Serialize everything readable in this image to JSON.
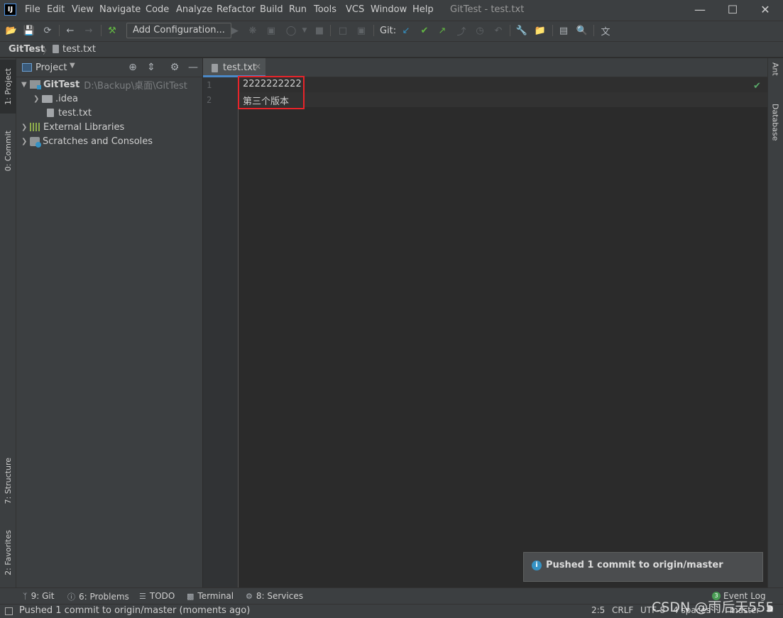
{
  "window": {
    "title": "GitTest - test.txt",
    "app_icon": "IJ",
    "minimize_glyph": "—",
    "maximize_glyph": "☐",
    "close_glyph": "✕"
  },
  "menu": [
    "File",
    "Edit",
    "View",
    "Navigate",
    "Code",
    "Analyze",
    "Refactor",
    "Build",
    "Run",
    "Tools",
    "VCS",
    "Window",
    "Help"
  ],
  "toolbar": {
    "add_configuration": "Add Configuration...",
    "git_label": "Git:"
  },
  "breadcrumb": {
    "project": "GitTest",
    "separator": "〉",
    "file": "test.txt"
  },
  "left_tabs": {
    "project": "1: Project",
    "commit": "0: Commit",
    "structure": "7: Structure",
    "favorites": "2: Favorites"
  },
  "right_tabs": {
    "ant": "Ant",
    "database": "Database"
  },
  "project_panel": {
    "title": "Project",
    "root_name": "GitTest",
    "root_path": "D:\\Backup\\桌面\\GitTest",
    "idea_folder": ".idea",
    "file": "test.txt",
    "external_libraries": "External Libraries",
    "scratches": "Scratches and Consoles"
  },
  "editor": {
    "tab_label": "test.txt",
    "line_numbers": [
      "1",
      "2"
    ],
    "lines": [
      "2222222222",
      "第三个版本"
    ],
    "highlight_color": "#e8242a"
  },
  "notification": {
    "text": "Pushed 1 commit to origin/master"
  },
  "bottom_tools": {
    "git": "9: Git",
    "problems": "6: Problems",
    "todo": "TODO",
    "terminal": "Terminal",
    "services": "8: Services",
    "event_log": "Event Log",
    "event_log_count": "3"
  },
  "status_bar": {
    "message": "Pushed 1 commit to origin/master (moments ago)",
    "position": "2:5",
    "line_separator": "CRLF",
    "encoding": "UTF-8",
    "indent": "4 spaces",
    "branch": "master"
  },
  "watermark": "CSDN @雨后天555"
}
